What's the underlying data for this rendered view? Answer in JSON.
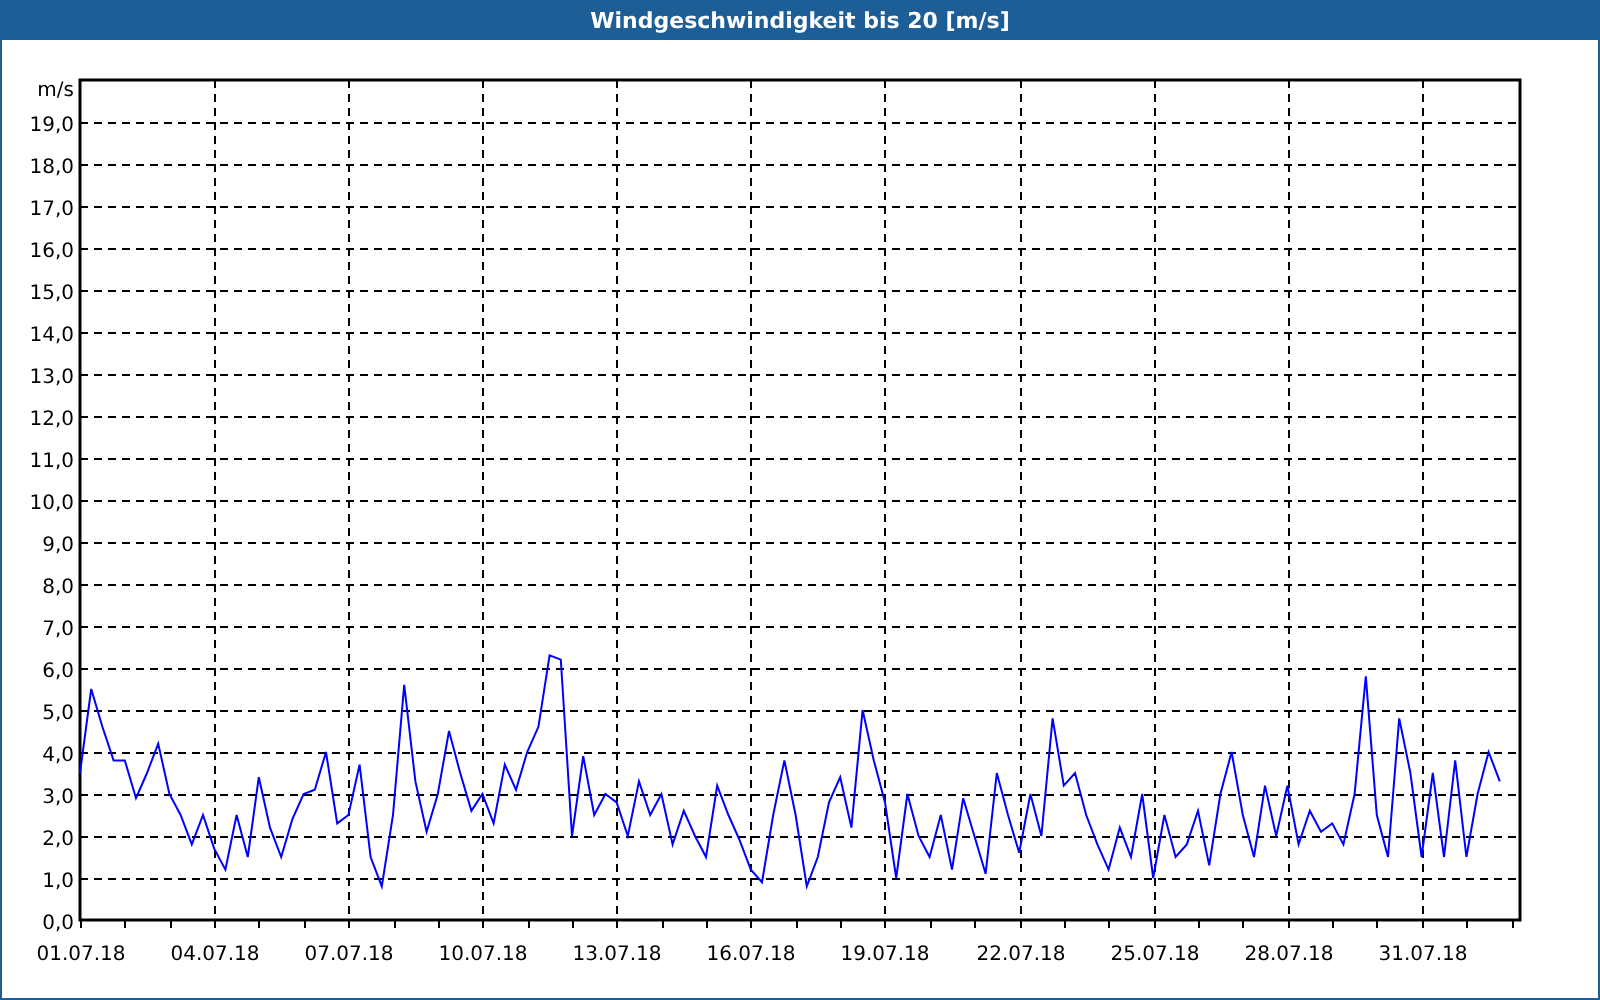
{
  "window": {
    "title": "Windgeschwindigkeit bis 20 [m/s]"
  },
  "chart_data": {
    "type": "line",
    "ylabel": "m/s",
    "ylim": [
      0,
      20
    ],
    "grid": true,
    "categories": [
      "01.07.18",
      null,
      null,
      null,
      null,
      null,
      null,
      null,
      null,
      null,
      null,
      null,
      "04.07.18",
      null,
      null,
      null,
      null,
      null,
      null,
      null,
      null,
      null,
      null,
      null,
      "07.07.18",
      null,
      null,
      null,
      null,
      null,
      null,
      null,
      null,
      null,
      null,
      null,
      "10.07.18",
      null,
      null,
      null,
      null,
      null,
      null,
      null,
      null,
      null,
      null,
      null,
      "13.07.18",
      null,
      null,
      null,
      null,
      null,
      null,
      null,
      null,
      null,
      null,
      null,
      "16.07.18",
      null,
      null,
      null,
      null,
      null,
      null,
      null,
      null,
      null,
      null,
      null,
      "19.07.18",
      null,
      null,
      null,
      null,
      null,
      null,
      null,
      null,
      null,
      null,
      null,
      "22.07.18",
      null,
      null,
      null,
      null,
      null,
      null,
      null,
      null,
      null,
      null,
      null,
      "25.07.18",
      null,
      null,
      null,
      null,
      null,
      null,
      null,
      null,
      null,
      null,
      null,
      "28.07.18",
      null,
      null,
      null,
      null,
      null,
      null,
      null,
      null,
      null,
      null,
      null,
      "31.07.18",
      null,
      null,
      null,
      null,
      null,
      null,
      null
    ],
    "yticks": [
      {
        "value": 0,
        "label": "0,0"
      },
      {
        "value": 1,
        "label": "1,0"
      },
      {
        "value": 2,
        "label": "2,0"
      },
      {
        "value": 3,
        "label": "3,0"
      },
      {
        "value": 4,
        "label": "4,0"
      },
      {
        "value": 5,
        "label": "5,0"
      },
      {
        "value": 6,
        "label": "6,0"
      },
      {
        "value": 7,
        "label": "7,0"
      },
      {
        "value": 8,
        "label": "8,0"
      },
      {
        "value": 9,
        "label": "9,0"
      },
      {
        "value": 10,
        "label": "10,0"
      },
      {
        "value": 11,
        "label": "11,0"
      },
      {
        "value": 12,
        "label": "12,0"
      },
      {
        "value": 13,
        "label": "13,0"
      },
      {
        "value": 14,
        "label": "14,0"
      },
      {
        "value": 15,
        "label": "15,0"
      },
      {
        "value": 16,
        "label": "16,0"
      },
      {
        "value": 17,
        "label": "17,0"
      },
      {
        "value": 18,
        "label": "18,0"
      },
      {
        "value": 19,
        "label": "19,0"
      }
    ],
    "series": [
      {
        "color": "#0000ff",
        "values": [
          3.5,
          5.5,
          4.6,
          3.8,
          3.8,
          2.9,
          3.5,
          4.2,
          3.0,
          2.5,
          1.8,
          2.5,
          1.7,
          1.2,
          2.5,
          1.5,
          3.4,
          2.2,
          1.5,
          2.4,
          3.0,
          3.1,
          4.0,
          2.3,
          2.5,
          3.7,
          1.5,
          0.8,
          2.5,
          5.6,
          3.3,
          2.1,
          3.0,
          4.5,
          3.5,
          2.6,
          3.0,
          2.3,
          3.7,
          3.1,
          4.0,
          4.6,
          6.3,
          6.2,
          2.0,
          3.9,
          2.5,
          3.0,
          2.8,
          2.0,
          3.3,
          2.5,
          3.0,
          1.8,
          2.6,
          2.0,
          1.5,
          3.2,
          2.5,
          1.9,
          1.2,
          0.9,
          2.5,
          3.8,
          2.5,
          0.8,
          1.5,
          2.8,
          3.4,
          2.2,
          5.0,
          3.8,
          2.8,
          1.0,
          3.0,
          2.0,
          1.5,
          2.5,
          1.2,
          2.9,
          2.0,
          1.1,
          3.5,
          2.5,
          1.6,
          3.0,
          2.0,
          4.8,
          3.2,
          3.5,
          2.5,
          1.8,
          1.2,
          2.2,
          1.5,
          3.0,
          1.0,
          2.5,
          1.5,
          1.8,
          2.6,
          1.3,
          3.0,
          4.0,
          2.5,
          1.5,
          3.2,
          2.0,
          3.2,
          1.8,
          2.6,
          2.1,
          2.3,
          1.8,
          3.0,
          5.8,
          2.5,
          1.5,
          4.8,
          3.5,
          1.5,
          3.5,
          1.5,
          3.8,
          1.5,
          3.0,
          4.0,
          3.3
        ]
      }
    ]
  }
}
